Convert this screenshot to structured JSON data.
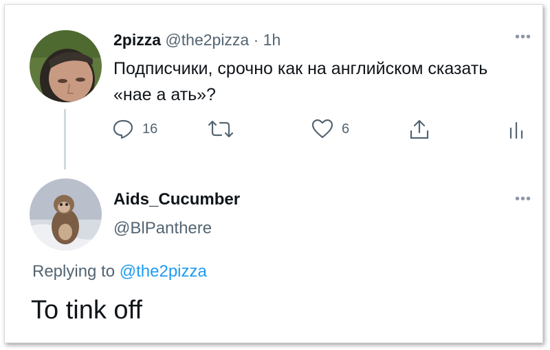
{
  "tweet": {
    "author_name": "2pizza",
    "author_handle": "@the2pizza",
    "time": "· 1h",
    "text": "Подписчики, срочно как на английском сказать «нае а ать»?",
    "reply_count": "16",
    "like_count": "6",
    "avatar_icon": "user-avatar",
    "more_icon": "more-icon"
  },
  "reply": {
    "author_name": "Aids_Cucumber",
    "author_handle": "@BlPanthere",
    "replying_prefix": "Replying to",
    "replying_to": "@the2pizza",
    "text": "To tink off",
    "avatar_icon": "monkey-avatar"
  },
  "colors": {
    "text": "#0f1419",
    "secondary": "#536471",
    "link": "#1d9bf0",
    "thread_line": "#cfd9de"
  }
}
